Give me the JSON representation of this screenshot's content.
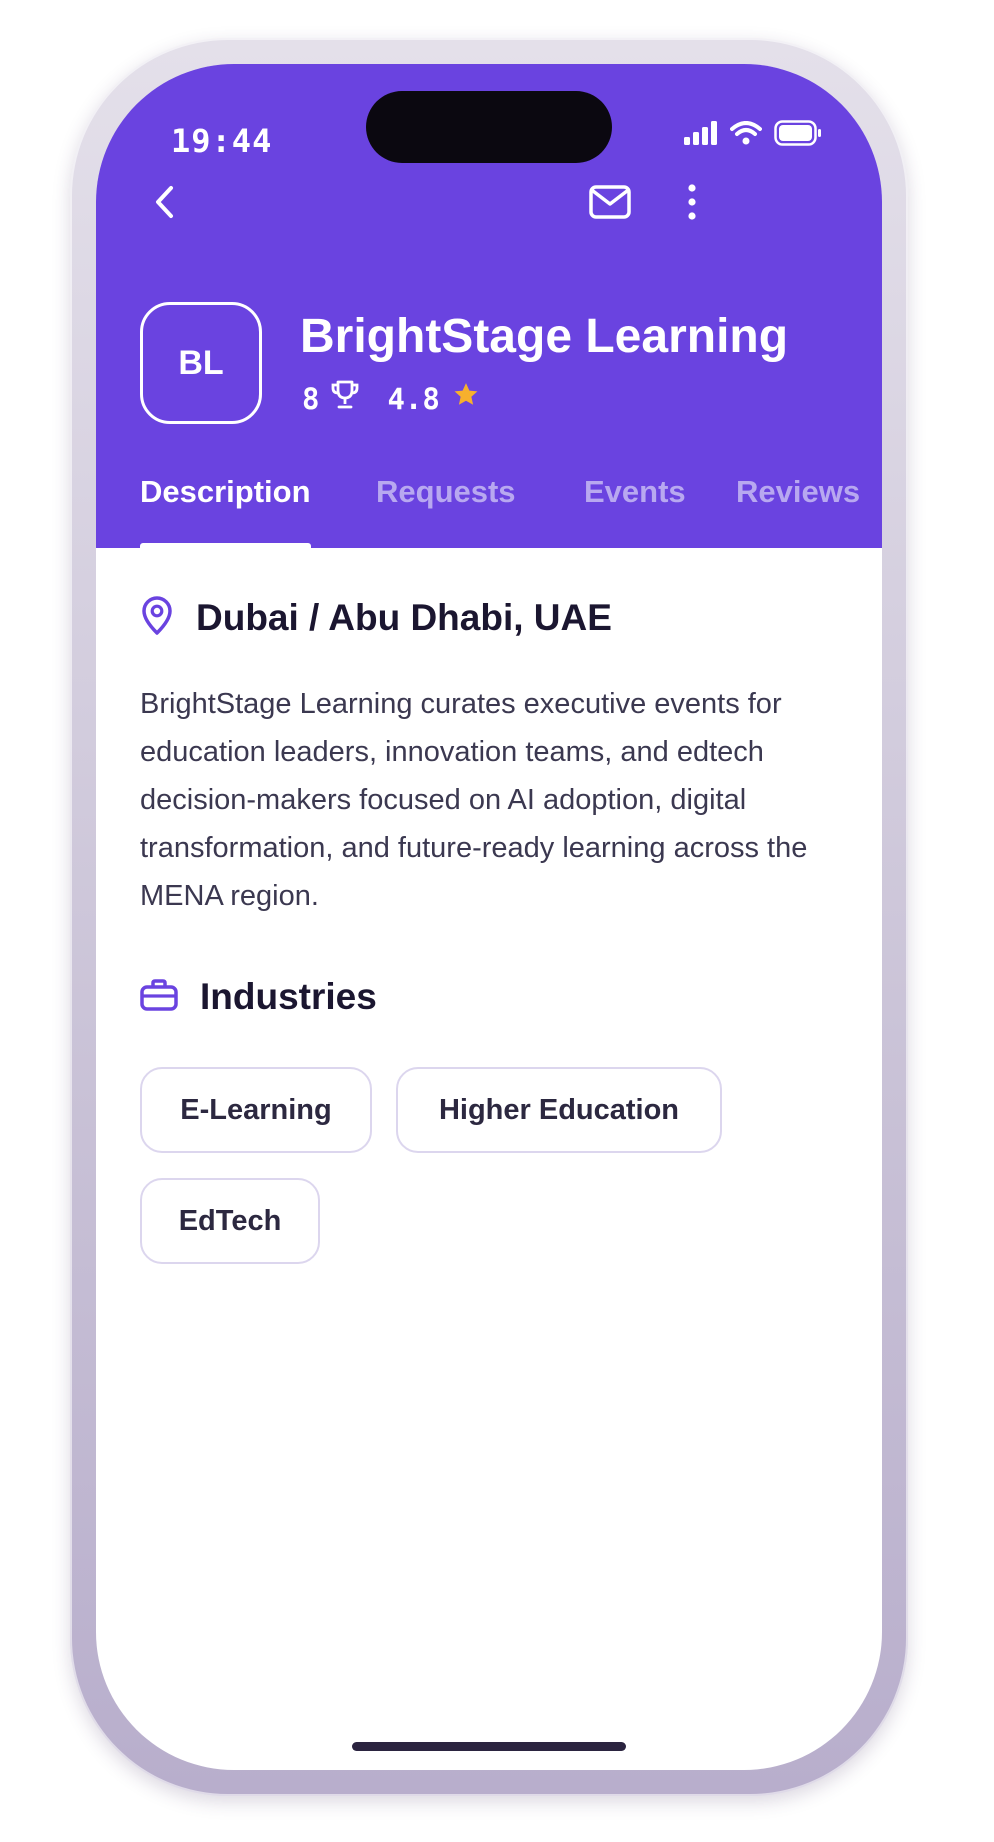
{
  "status_bar": {
    "time": "19:44"
  },
  "organization": {
    "initials": "BL",
    "name": "BrightStage Learning",
    "trophies": "8",
    "rating": "4.8"
  },
  "tabs": [
    {
      "label": "Description",
      "active": true
    },
    {
      "label": "Requests"
    },
    {
      "label": "Events"
    },
    {
      "label": "Reviews"
    }
  ],
  "location": "Dubai / Abu Dhabi, UAE",
  "description": "BrightStage Learning curates executive events for education leaders, innovation teams, and edtech decision-makers focused on AI adoption, digital transformation, and future-ready learning across the MENA region.",
  "industries": {
    "title": "Industries",
    "chips": [
      "E-Learning",
      "Higher Education",
      "EdTech"
    ]
  },
  "colors": {
    "primary": "#6a43e0",
    "star": "#f7b02d",
    "text_dark": "#1b1630",
    "chip_border": "#dcd6ee"
  },
  "icons": [
    "back-icon",
    "mail-icon",
    "more-vertical-icon",
    "trophy-icon",
    "star-icon",
    "location-pin-icon",
    "briefcase-icon",
    "signal-icon",
    "wifi-icon",
    "battery-icon"
  ]
}
